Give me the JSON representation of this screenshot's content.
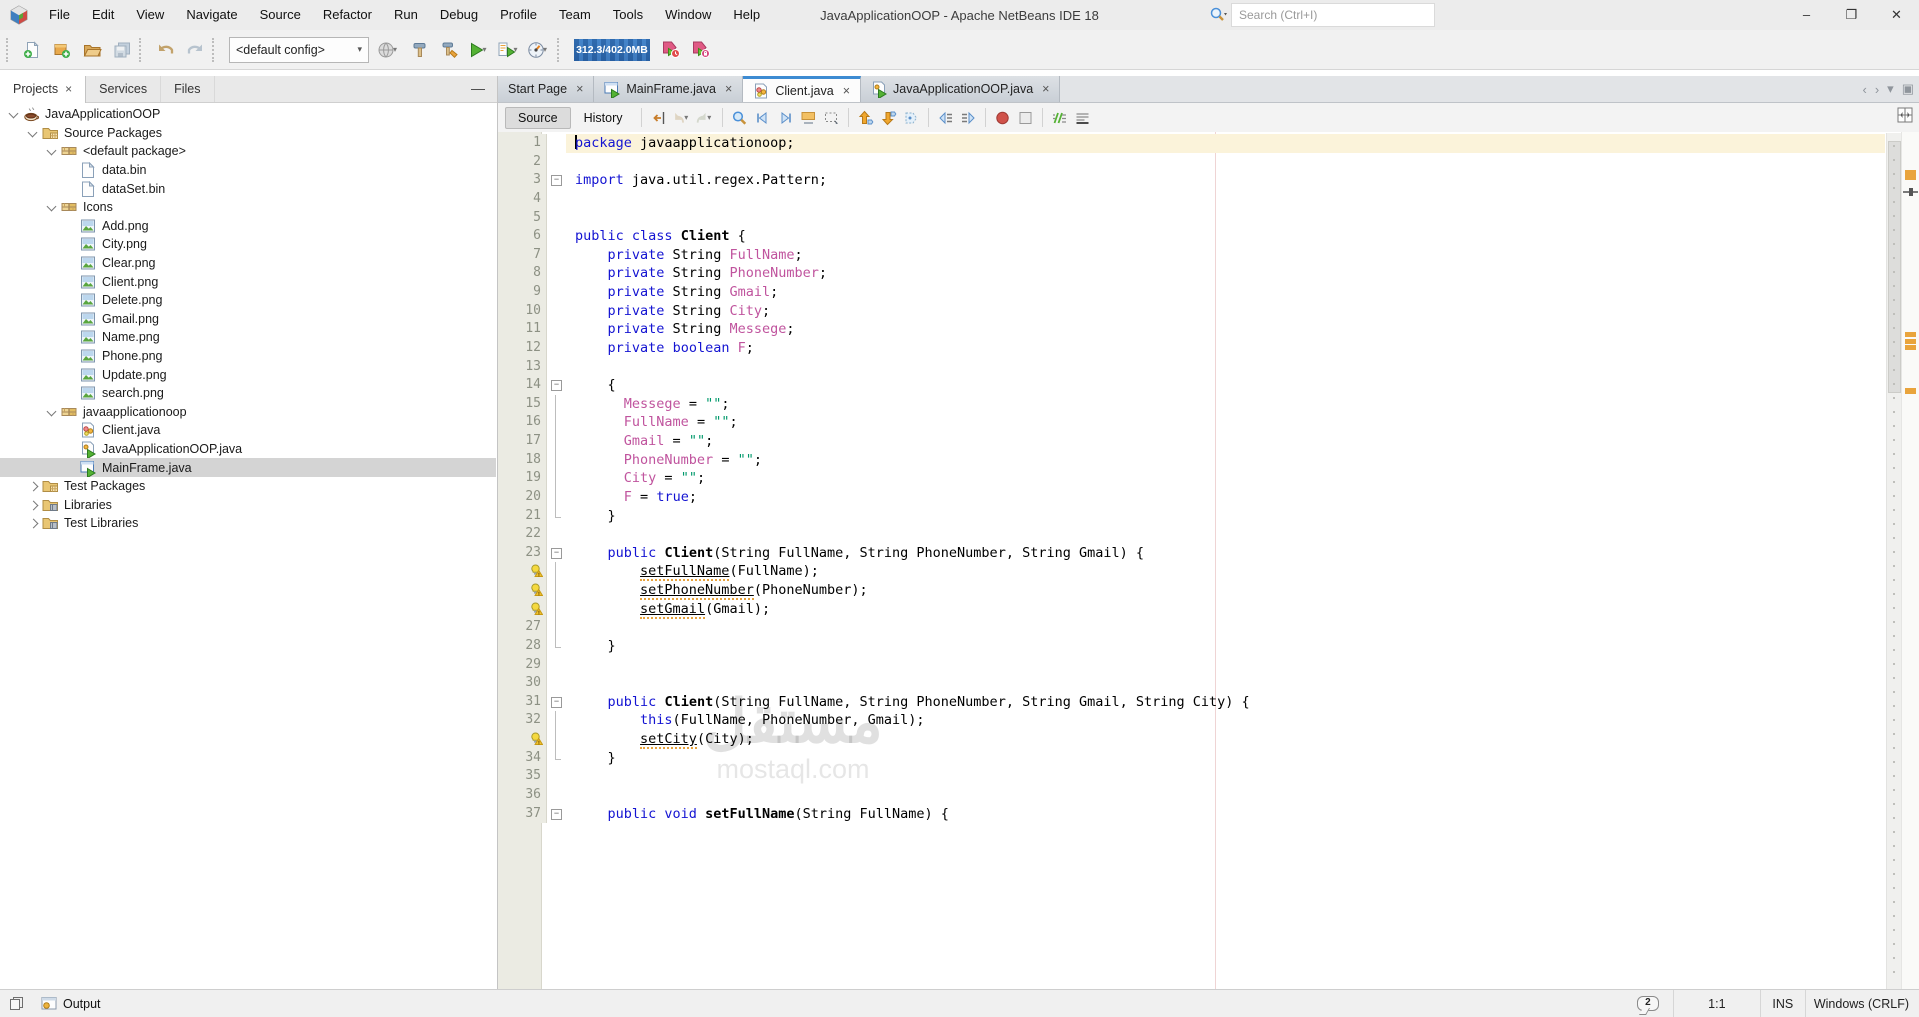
{
  "window": {
    "title": "JavaApplicationOOP - Apache NetBeans IDE 18",
    "buttons": [
      "minimize",
      "maximize",
      "close"
    ]
  },
  "menubar": {
    "items": [
      "File",
      "Edit",
      "View",
      "Navigate",
      "Source",
      "Refactor",
      "Run",
      "Debug",
      "Profile",
      "Team",
      "Tools",
      "Window",
      "Help"
    ]
  },
  "search": {
    "placeholder": "Search (Ctrl+I)",
    "icon": "search-icon",
    "value": ""
  },
  "toolbar": {
    "config_value": "<default config>",
    "memory": "312.3/402.0MB",
    "items": [
      {
        "type": "grip"
      },
      {
        "type": "icon",
        "name": "new-file"
      },
      {
        "type": "icon",
        "name": "new-project"
      },
      {
        "type": "icon",
        "name": "open-project"
      },
      {
        "type": "icon",
        "name": "save-all"
      },
      {
        "type": "grip"
      },
      {
        "type": "icon",
        "name": "undo"
      },
      {
        "type": "icon",
        "name": "redo"
      },
      {
        "type": "grip"
      },
      {
        "type": "config"
      },
      {
        "type": "icon",
        "name": "set-configuration-globe",
        "dd": true
      },
      {
        "type": "icon",
        "name": "build-project"
      },
      {
        "type": "icon",
        "name": "clean-build-project"
      },
      {
        "type": "icon",
        "name": "run-project",
        "dd": true
      },
      {
        "type": "icon",
        "name": "debug-project",
        "dd": true
      },
      {
        "type": "icon",
        "name": "profile-project",
        "dd": true
      },
      {
        "type": "grip"
      },
      {
        "type": "memory"
      },
      {
        "type": "icon",
        "name": "profile-point-time"
      },
      {
        "type": "icon",
        "name": "profile-point-lock"
      }
    ]
  },
  "left_panel": {
    "tabs": [
      {
        "label": "Projects",
        "closable": true,
        "active": true
      },
      {
        "label": "Services",
        "closable": false,
        "active": false
      },
      {
        "label": "Files",
        "closable": false,
        "active": false
      }
    ],
    "tree": [
      {
        "label": "JavaApplicationOOP",
        "level": 0,
        "chev": "down",
        "icon": "java-project"
      },
      {
        "label": "Source Packages",
        "level": 1,
        "chev": "down",
        "icon": "folder-packages"
      },
      {
        "label": "<default package>",
        "level": 2,
        "chev": "down",
        "icon": "package"
      },
      {
        "label": "data.bin",
        "level": 3,
        "chev": "none",
        "icon": "file-generic"
      },
      {
        "label": "dataSet.bin",
        "level": 3,
        "chev": "none",
        "icon": "file-generic"
      },
      {
        "label": "Icons",
        "level": 2,
        "chev": "down",
        "icon": "package"
      },
      {
        "label": "Add.png",
        "level": 3,
        "chev": "none",
        "icon": "file-image"
      },
      {
        "label": "City.png",
        "level": 3,
        "chev": "none",
        "icon": "file-image"
      },
      {
        "label": "Clear.png",
        "level": 3,
        "chev": "none",
        "icon": "file-image"
      },
      {
        "label": "Client.png",
        "level": 3,
        "chev": "none",
        "icon": "file-image"
      },
      {
        "label": "Delete.png",
        "level": 3,
        "chev": "none",
        "icon": "file-image"
      },
      {
        "label": "Gmail.png",
        "level": 3,
        "chev": "none",
        "icon": "file-image"
      },
      {
        "label": "Name.png",
        "level": 3,
        "chev": "none",
        "icon": "file-image"
      },
      {
        "label": "Phone.png",
        "level": 3,
        "chev": "none",
        "icon": "file-image"
      },
      {
        "label": "Update.png",
        "level": 3,
        "chev": "none",
        "icon": "file-image"
      },
      {
        "label": "search.png",
        "level": 3,
        "chev": "none",
        "icon": "file-image"
      },
      {
        "label": "javaapplicationoop",
        "level": 2,
        "chev": "down",
        "icon": "package"
      },
      {
        "label": "Client.java",
        "level": 3,
        "chev": "none",
        "icon": "java-class"
      },
      {
        "label": "JavaApplicationOOP.java",
        "level": 3,
        "chev": "none",
        "icon": "java-main"
      },
      {
        "label": "MainFrame.java",
        "level": 3,
        "chev": "none",
        "icon": "java-form",
        "selected": true
      },
      {
        "label": "Test Packages",
        "level": 1,
        "chev": "right",
        "icon": "folder-packages"
      },
      {
        "label": "Libraries",
        "level": 1,
        "chev": "right",
        "icon": "folder-libraries"
      },
      {
        "label": "Test Libraries",
        "level": 1,
        "chev": "right",
        "icon": "folder-libraries"
      }
    ]
  },
  "editor": {
    "tabs": [
      {
        "label": "Start Page",
        "icon": null,
        "active": false
      },
      {
        "label": "MainFrame.java",
        "icon": "java-form",
        "active": false
      },
      {
        "label": "Client.java",
        "icon": "java-class",
        "active": true
      },
      {
        "label": "JavaApplicationOOP.java",
        "icon": "java-main",
        "active": false
      }
    ],
    "tab_controls": [
      "scroll-tabs-left",
      "scroll-tabs-right",
      "tab-list-dropdown",
      "maximize-window"
    ],
    "toolbar": {
      "source_label": "Source",
      "history_label": "History",
      "icons": [
        "last-edit-position",
        "back",
        "forward",
        "sep",
        "find-selection",
        "find-previous",
        "find-next",
        "toggle-highlight",
        "rectangular-selection",
        "sep",
        "previous-bookmark",
        "next-bookmark",
        "bookmark-list",
        "sep",
        "shift-line-left",
        "shift-line-right",
        "sep",
        "start-macro-recording",
        "stop-macro-recording",
        "sep",
        "comment",
        "uncomment"
      ],
      "split_icon": "split-document"
    },
    "code_lines": [
      {
        "n": "1",
        "cur": true,
        "caret": true,
        "t": [
          [
            "kw",
            "package"
          ],
          [
            "pl",
            " javaapplicationoop;"
          ]
        ]
      },
      {
        "n": "2",
        "t": []
      },
      {
        "n": "3",
        "fold": true,
        "t": [
          [
            "kw",
            "import"
          ],
          [
            "pl",
            " java.util.regex.Pattern;"
          ]
        ]
      },
      {
        "n": "4",
        "t": []
      },
      {
        "n": "5",
        "t": []
      },
      {
        "n": "6",
        "t": [
          [
            "kw",
            "public class"
          ],
          [
            "pl",
            " "
          ],
          [
            "b",
            "Client"
          ],
          [
            "pl",
            " {"
          ]
        ]
      },
      {
        "n": "7",
        "t": [
          [
            "pl",
            "    "
          ],
          [
            "kw",
            "private"
          ],
          [
            "pl",
            " String "
          ],
          [
            "f",
            "FullName"
          ],
          [
            "pl",
            ";"
          ]
        ]
      },
      {
        "n": "8",
        "t": [
          [
            "pl",
            "    "
          ],
          [
            "kw",
            "private"
          ],
          [
            "pl",
            " String "
          ],
          [
            "f",
            "PhoneNumber"
          ],
          [
            "pl",
            ";"
          ]
        ]
      },
      {
        "n": "9",
        "t": [
          [
            "pl",
            "    "
          ],
          [
            "kw",
            "private"
          ],
          [
            "pl",
            " String "
          ],
          [
            "f",
            "Gmail"
          ],
          [
            "pl",
            ";"
          ]
        ]
      },
      {
        "n": "10",
        "t": [
          [
            "pl",
            "    "
          ],
          [
            "kw",
            "private"
          ],
          [
            "pl",
            " String "
          ],
          [
            "f",
            "City"
          ],
          [
            "pl",
            ";"
          ]
        ]
      },
      {
        "n": "11",
        "t": [
          [
            "pl",
            "    "
          ],
          [
            "kw",
            "private"
          ],
          [
            "pl",
            " String "
          ],
          [
            "f",
            "Messege"
          ],
          [
            "pl",
            ";"
          ]
        ]
      },
      {
        "n": "12",
        "t": [
          [
            "pl",
            "    "
          ],
          [
            "kw",
            "private"
          ],
          [
            "pl",
            " "
          ],
          [
            "kw",
            "boolean"
          ],
          [
            "pl",
            " "
          ],
          [
            "f",
            "F"
          ],
          [
            "pl",
            ";"
          ]
        ]
      },
      {
        "n": "13",
        "t": []
      },
      {
        "n": "14",
        "fold": true,
        "t": [
          [
            "pl",
            "    {"
          ]
        ]
      },
      {
        "n": "15",
        "guide": "mid",
        "t": [
          [
            "pl",
            "      "
          ],
          [
            "f",
            "Messege"
          ],
          [
            "pl",
            " = "
          ],
          [
            "s",
            "\"\""
          ],
          [
            "pl",
            ";"
          ]
        ]
      },
      {
        "n": "16",
        "guide": "mid",
        "t": [
          [
            "pl",
            "      "
          ],
          [
            "f",
            "FullName"
          ],
          [
            "pl",
            " = "
          ],
          [
            "s",
            "\"\""
          ],
          [
            "pl",
            ";"
          ]
        ]
      },
      {
        "n": "17",
        "guide": "mid",
        "t": [
          [
            "pl",
            "      "
          ],
          [
            "f",
            "Gmail"
          ],
          [
            "pl",
            " = "
          ],
          [
            "s",
            "\"\""
          ],
          [
            "pl",
            ";"
          ]
        ]
      },
      {
        "n": "18",
        "guide": "mid",
        "t": [
          [
            "pl",
            "      "
          ],
          [
            "f",
            "PhoneNumber"
          ],
          [
            "pl",
            " = "
          ],
          [
            "s",
            "\"\""
          ],
          [
            "pl",
            ";"
          ]
        ]
      },
      {
        "n": "19",
        "guide": "mid",
        "t": [
          [
            "pl",
            "      "
          ],
          [
            "f",
            "City"
          ],
          [
            "pl",
            " = "
          ],
          [
            "s",
            "\"\""
          ],
          [
            "pl",
            ";"
          ]
        ]
      },
      {
        "n": "20",
        "guide": "mid",
        "t": [
          [
            "pl",
            "      "
          ],
          [
            "f",
            "F"
          ],
          [
            "pl",
            " = "
          ],
          [
            "kw",
            "true"
          ],
          [
            "pl",
            ";"
          ]
        ]
      },
      {
        "n": "21",
        "guide": "end",
        "t": [
          [
            "pl",
            "    }"
          ]
        ]
      },
      {
        "n": "22",
        "t": []
      },
      {
        "n": "23",
        "fold": true,
        "t": [
          [
            "pl",
            "    "
          ],
          [
            "kw",
            "public"
          ],
          [
            "pl",
            " "
          ],
          [
            "b",
            "Client"
          ],
          [
            "pl",
            "(String FullName, String PhoneNumber, String Gmail) {"
          ]
        ]
      },
      {
        "n": "24",
        "glyph": "bulb",
        "guide": "mid",
        "t": [
          [
            "pl",
            "        "
          ],
          [
            "warn",
            "setFullName"
          ],
          [
            "pl",
            "(FullName);"
          ]
        ]
      },
      {
        "n": "25",
        "glyph": "bulb",
        "guide": "mid",
        "t": [
          [
            "pl",
            "        "
          ],
          [
            "warn",
            "setPhoneNumber"
          ],
          [
            "pl",
            "(PhoneNumber);"
          ]
        ]
      },
      {
        "n": "26",
        "glyph": "bulb",
        "guide": "mid",
        "t": [
          [
            "pl",
            "        "
          ],
          [
            "warn",
            "setGmail"
          ],
          [
            "pl",
            "(Gmail);"
          ]
        ]
      },
      {
        "n": "27",
        "guide": "mid",
        "t": []
      },
      {
        "n": "28",
        "guide": "end",
        "t": [
          [
            "pl",
            "    }"
          ]
        ]
      },
      {
        "n": "29",
        "t": []
      },
      {
        "n": "30",
        "t": []
      },
      {
        "n": "31",
        "fold": true,
        "t": [
          [
            "pl",
            "    "
          ],
          [
            "kw",
            "public"
          ],
          [
            "pl",
            " "
          ],
          [
            "b",
            "Client"
          ],
          [
            "pl",
            "(String FullName, String PhoneNumber, String Gmail, String City) {"
          ]
        ]
      },
      {
        "n": "32",
        "guide": "mid",
        "t": [
          [
            "pl",
            "        "
          ],
          [
            "kw",
            "this"
          ],
          [
            "pl",
            "(FullName, PhoneNumber, Gmail);"
          ]
        ]
      },
      {
        "n": "33",
        "glyph": "bulb",
        "guide": "mid",
        "t": [
          [
            "pl",
            "        "
          ],
          [
            "warn",
            "setCity"
          ],
          [
            "pl",
            "(City);"
          ]
        ]
      },
      {
        "n": "34",
        "guide": "end",
        "t": [
          [
            "pl",
            "    }"
          ]
        ]
      },
      {
        "n": "35",
        "t": []
      },
      {
        "n": "36",
        "t": []
      },
      {
        "n": "37",
        "fold": true,
        "t": [
          [
            "pl",
            "    "
          ],
          [
            "kw",
            "public void"
          ],
          [
            "pl",
            " "
          ],
          [
            "b",
            "setFullName"
          ],
          [
            "pl",
            "(String FullName) {"
          ]
        ]
      }
    ],
    "colors": {
      "keyword": "#1414d2",
      "field": "#c0549e",
      "string": "#00996b",
      "current_line": "#fbf3da",
      "warning_mark": "#e9a43c",
      "selected_tab_accent": "#3d8bd2"
    }
  },
  "watermark": {
    "line1": "مستقل",
    "line2": "mostaql.com"
  },
  "statusbar": {
    "output_label": "Output",
    "notifications_count": "2",
    "caret_position": "1:1",
    "insert_mode": "INS",
    "line_ending": "Windows (CRLF)"
  }
}
